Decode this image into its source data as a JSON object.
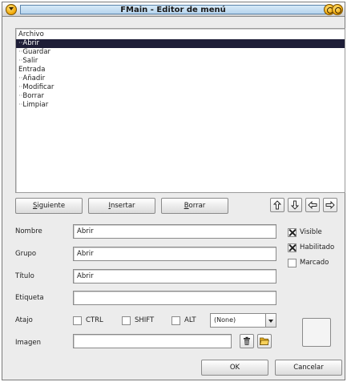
{
  "window": {
    "title": "FMain - Editor de menú"
  },
  "tree": {
    "items": [
      {
        "lead": "",
        "label": "Archivo"
      },
      {
        "lead": "··",
        "label": "Abrir"
      },
      {
        "lead": "··",
        "label": "Guardar"
      },
      {
        "lead": "··",
        "label": "Salir"
      },
      {
        "lead": "",
        "label": "Entrada"
      },
      {
        "lead": "··",
        "label": "Añadir"
      },
      {
        "lead": "··",
        "label": "Modificar"
      },
      {
        "lead": "··",
        "label": "Borrar"
      },
      {
        "lead": "··",
        "label": "Limpiar"
      }
    ],
    "selected_index": 1
  },
  "toolbar": {
    "next": {
      "mnemonic": "S",
      "rest": "iguiente"
    },
    "insert": {
      "mnemonic": "I",
      "rest": "nsertar"
    },
    "delete": {
      "mnemonic": "B",
      "rest": "orrar"
    },
    "arrows": [
      "up-arrow-icon",
      "down-arrow-icon",
      "left-arrow-icon",
      "right-arrow-icon"
    ]
  },
  "form": {
    "name_label": "Nombre",
    "name_value": "Abrir",
    "group_label": "Grupo",
    "group_value": "Abrir",
    "title_label": "Título",
    "title_value": "Abrir",
    "tag_label": "Etiqueta",
    "tag_value": "",
    "shortcut_label": "Atajo",
    "ctrl_label": "CTRL",
    "shift_label": "SHIFT",
    "alt_label": "ALT",
    "key_value": "(None)",
    "image_label": "Imagen",
    "image_value": ""
  },
  "options": {
    "visible_label": "Visible",
    "visible_checked": true,
    "enabled_label": "Habilitado",
    "enabled_checked": true,
    "checked_label": "Marcado",
    "checked_checked": false
  },
  "footer": {
    "ok_label": "OK",
    "cancel_label": "Cancelar"
  },
  "colors": {
    "selection": "#1e1e38",
    "title_bar": "#b6d4ee",
    "window_button": "#f0a400"
  }
}
